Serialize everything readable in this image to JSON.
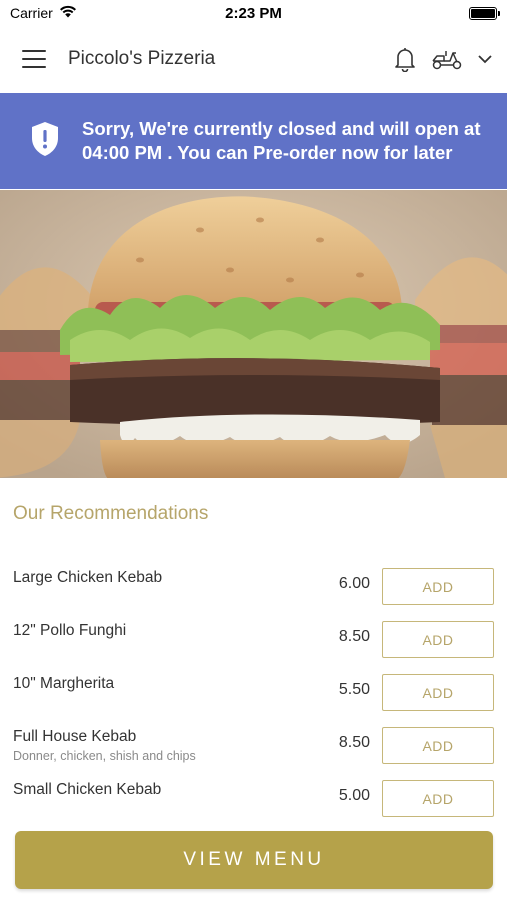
{
  "status_bar": {
    "carrier": "Carrier",
    "time": "2:23 PM"
  },
  "header": {
    "title": "Piccolo's Pizzeria",
    "icons": [
      "menu-icon",
      "bell-icon",
      "scooter-icon",
      "chevron-down-icon"
    ]
  },
  "banner": {
    "message": "Sorry, We're currently closed and will open at 04:00 PM . You can Pre-order now for later",
    "background": "#6072c7"
  },
  "recommendations": {
    "title": "Our Recommendations",
    "add_label": "ADD",
    "items": [
      {
        "name": "Large Chicken Kebab",
        "description": "",
        "price": "6.00"
      },
      {
        "name": "12\" Pollo Funghi",
        "description": "",
        "price": "8.50"
      },
      {
        "name": "10\" Margherita",
        "description": "",
        "price": "5.50"
      },
      {
        "name": "Full House Kebab",
        "description": "Donner, chicken, shish and chips",
        "price": "8.50"
      },
      {
        "name": "Small Chicken Kebab",
        "description": "",
        "price": "5.00"
      }
    ]
  },
  "view_menu_label": "VIEW MENU",
  "colors": {
    "accent": "#b5a24a",
    "accent_text": "#b6a56a",
    "banner": "#6072c7"
  }
}
